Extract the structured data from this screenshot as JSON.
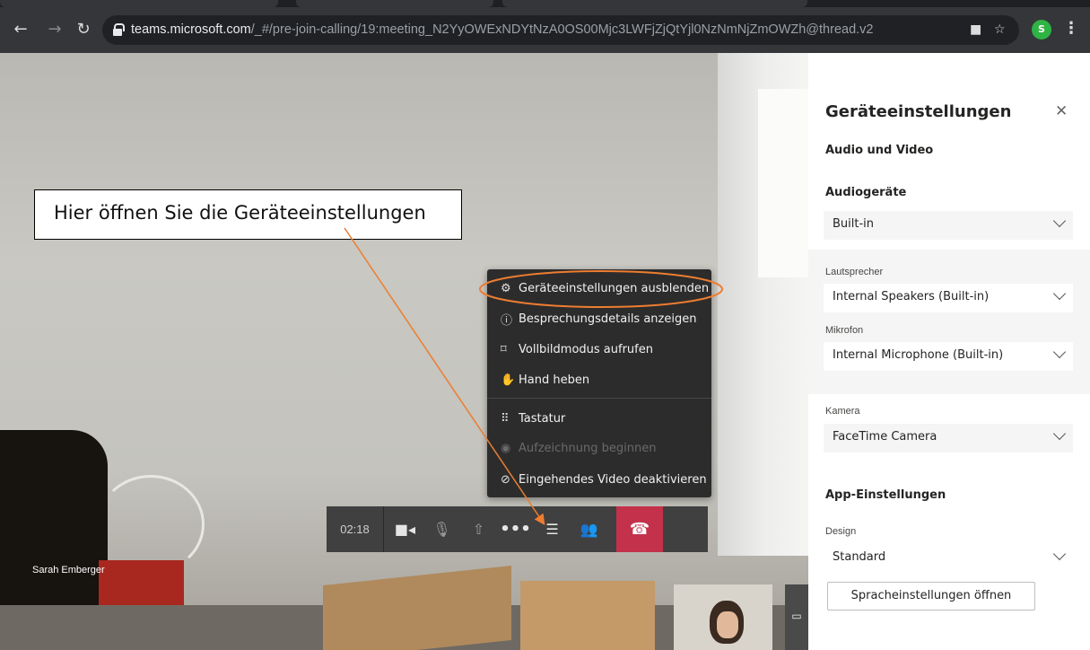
{
  "browser": {
    "url_domain": "teams.microsoft.com",
    "url_path": "/_#/pre-join-calling/19:meeting_N2YyOWExNDYtNzA0OS00Mjc3LWFjZjQtYjl0NzNmNjZmOWZh@thread.v2",
    "profile_initial": "S"
  },
  "stage": {
    "participant_name": "Sarah Emberger"
  },
  "callout": {
    "text": "Hier öffnen Sie die Geräteeinstellungen"
  },
  "more_menu": {
    "items": [
      {
        "label": "Geräteeinstellungen ausblenden",
        "icon": "gear-icon",
        "enabled": true
      },
      {
        "label": "Besprechungsdetails anzeigen",
        "icon": "info-icon",
        "enabled": true
      },
      {
        "label": "Vollbildmodus aufrufen",
        "icon": "fullscreen-icon",
        "enabled": true
      },
      {
        "label": "Hand heben",
        "icon": "hand-icon",
        "enabled": true
      },
      {
        "label": "Tastatur",
        "icon": "dialpad-icon",
        "enabled": true
      },
      {
        "label": "Aufzeichnung beginnen",
        "icon": "record-icon",
        "enabled": false
      },
      {
        "label": "Eingehendes Video deaktivieren",
        "icon": "video-off-icon",
        "enabled": true
      }
    ]
  },
  "call_bar": {
    "timer": "02:18",
    "hangup_color": "#c4314b"
  },
  "settings": {
    "title": "Geräteeinstellungen",
    "audio_video_heading": "Audio und Video",
    "audio_devices_heading": "Audiogeräte",
    "audio_device_value": "Built-in",
    "speaker_label": "Lautsprecher",
    "speaker_value": "Internal Speakers (Built-in)",
    "mic_label": "Mikrofon",
    "mic_value": "Internal Microphone (Built-in)",
    "camera_label": "Kamera",
    "camera_value": "FaceTime Camera",
    "app_settings_heading": "App-Einstellungen",
    "design_label": "Design",
    "design_value": "Standard",
    "language_button": "Spracheinstellungen öffnen"
  },
  "colors": {
    "annotation_orange": "#ed7d31",
    "menu_bg": "#2d2c2c"
  }
}
